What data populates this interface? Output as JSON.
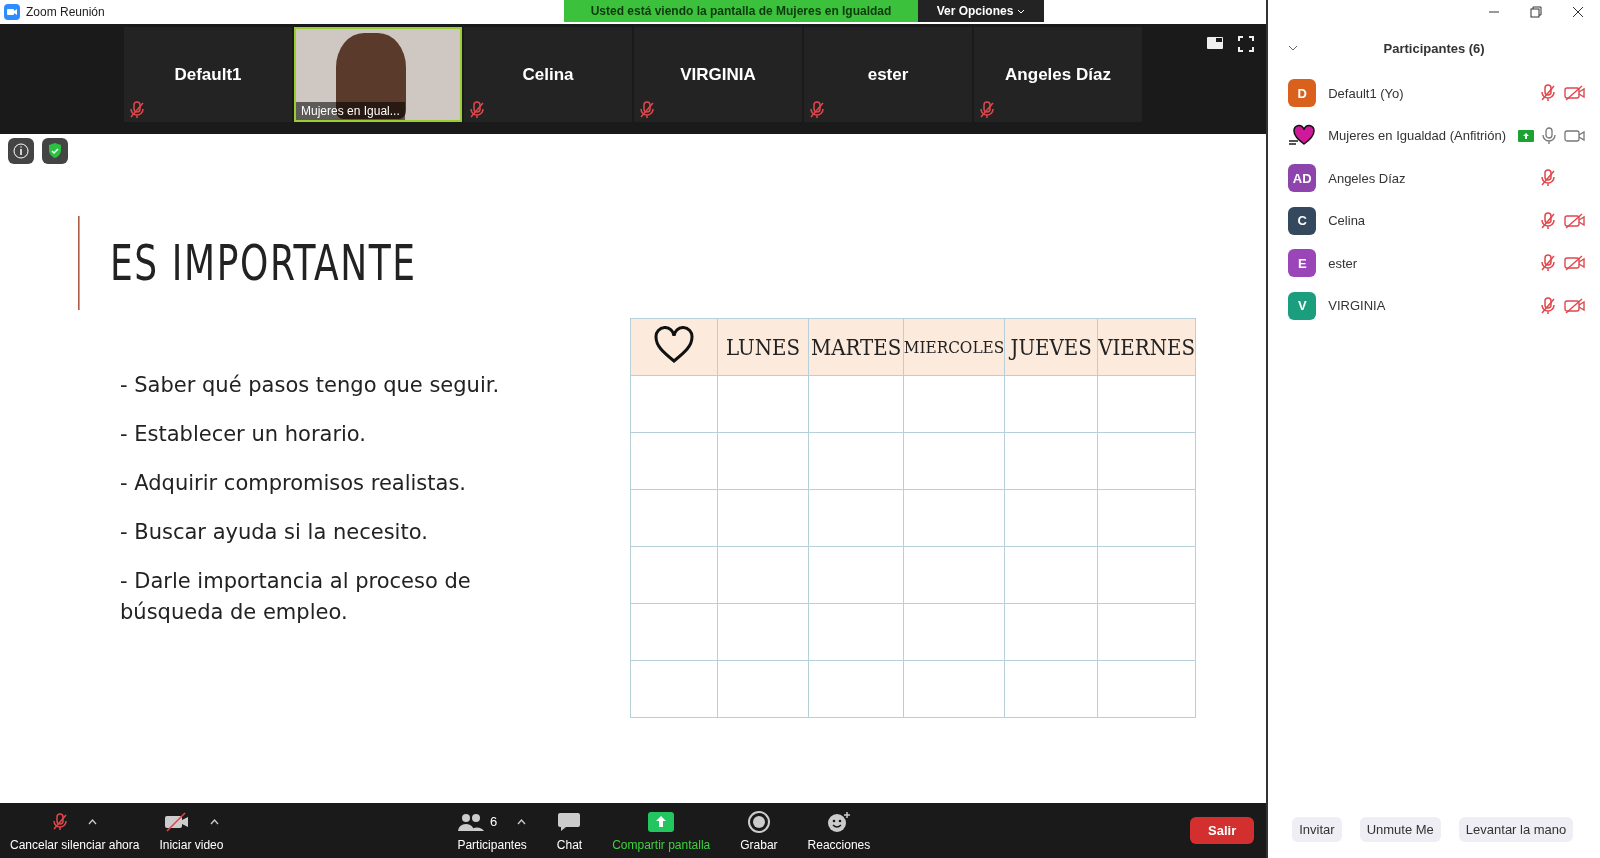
{
  "window": {
    "title": "Zoom Reunión"
  },
  "banner": {
    "text": "Usted está viendo la pantalla de Mujeres en Igualdad",
    "options_button": "Ver Opciones"
  },
  "video_strip": [
    {
      "kind": "name",
      "name": "Default1",
      "muted": true
    },
    {
      "kind": "video",
      "name": "Mujeres en Igual...",
      "muted": false
    },
    {
      "kind": "name",
      "name": "Celina",
      "muted": true
    },
    {
      "kind": "name",
      "name": "VIRGINIA",
      "muted": true
    },
    {
      "kind": "name",
      "name": "ester",
      "muted": true
    },
    {
      "kind": "name",
      "name": "Angeles Díaz",
      "muted": true
    }
  ],
  "slide": {
    "title": "ES IMPORTANTE",
    "bullets": [
      "- Saber qué pasos tengo que seguir.",
      "- Establecer un horario.",
      "- Adquirir compromisos realistas.",
      "- Buscar ayuda si la necesito.",
      "- Darle importancia al proceso de búsqueda de empleo."
    ],
    "schedule_columns": [
      "LUNES",
      "MARTES",
      "MIERCOLES",
      "JUEVES",
      "VIERNES"
    ]
  },
  "participants": {
    "title": "Participantes (6)",
    "items": [
      {
        "kind": "initials",
        "initials": "D",
        "color": "#d9611c",
        "name": "Default1 (Yo)",
        "sharing": false,
        "muted": true,
        "camera_shown": true,
        "video_on": false
      },
      {
        "kind": "logo",
        "name": "Mujeres en Igualdad (Anfitrión)",
        "sharing": true,
        "muted": false,
        "camera_shown": true,
        "video_on": true
      },
      {
        "kind": "initials",
        "initials": "AD",
        "color": "#8e44ad",
        "name": "Angeles Díaz",
        "sharing": false,
        "muted": true,
        "camera_shown": false
      },
      {
        "kind": "initials",
        "initials": "C",
        "color": "#34495e",
        "name": "Celina",
        "sharing": false,
        "muted": true,
        "camera_shown": true,
        "video_on": false
      },
      {
        "kind": "initials",
        "initials": "E",
        "color": "#9b46b8",
        "name": "ester",
        "sharing": false,
        "muted": true,
        "camera_shown": true,
        "video_on": false
      },
      {
        "kind": "initials",
        "initials": "V",
        "color": "#1a9e7e",
        "name": "VIRGINIA",
        "sharing": false,
        "muted": true,
        "camera_shown": true,
        "video_on": false
      }
    ],
    "buttons": [
      "Invitar",
      "Unmute Me",
      "Levantar la mano"
    ]
  },
  "toolbar": {
    "left": [
      {
        "kind": "mic",
        "label": "Cancelar silenciar ahora"
      },
      {
        "kind": "video",
        "label": "Iniciar video"
      }
    ],
    "center": [
      {
        "kind": "participants",
        "label": "Participantes",
        "count": "6"
      },
      {
        "kind": "chat",
        "label": "Chat"
      },
      {
        "kind": "share",
        "label": "Compartir pantalla"
      },
      {
        "kind": "record",
        "label": "Grabar"
      },
      {
        "kind": "reactions",
        "label": "Reacciones"
      }
    ],
    "leave_button": "Salir"
  }
}
